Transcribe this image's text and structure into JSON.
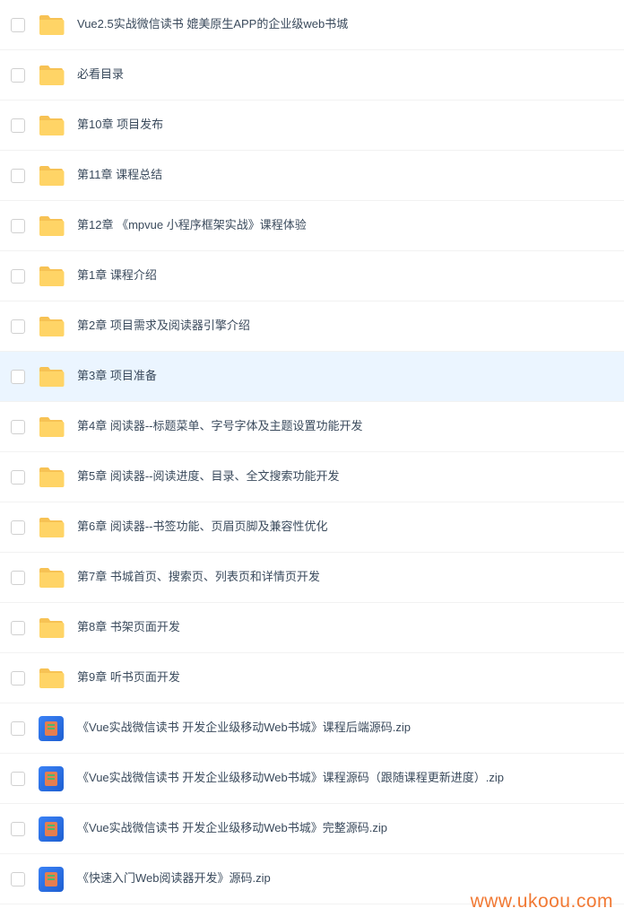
{
  "items": [
    {
      "type": "folder",
      "name": "Vue2.5实战微信读书 媲美原生APP的企业级web书城",
      "selected": false
    },
    {
      "type": "folder",
      "name": "必看目录",
      "selected": false
    },
    {
      "type": "folder",
      "name": "第10章 项目发布",
      "selected": false
    },
    {
      "type": "folder",
      "name": "第11章 课程总结",
      "selected": false
    },
    {
      "type": "folder",
      "name": "第12章 《mpvue 小程序框架实战》课程体验",
      "selected": false
    },
    {
      "type": "folder",
      "name": "第1章 课程介绍",
      "selected": false
    },
    {
      "type": "folder",
      "name": "第2章 项目需求及阅读器引擎介绍",
      "selected": false
    },
    {
      "type": "folder",
      "name": "第3章 项目准备",
      "selected": true
    },
    {
      "type": "folder",
      "name": "第4章 阅读器--标题菜单、字号字体及主题设置功能开发",
      "selected": false
    },
    {
      "type": "folder",
      "name": "第5章 阅读器--阅读进度、目录、全文搜索功能开发",
      "selected": false
    },
    {
      "type": "folder",
      "name": "第6章 阅读器--书签功能、页眉页脚及兼容性优化",
      "selected": false
    },
    {
      "type": "folder",
      "name": "第7章 书城首页、搜索页、列表页和详情页开发",
      "selected": false
    },
    {
      "type": "folder",
      "name": "第8章 书架页面开发",
      "selected": false
    },
    {
      "type": "folder",
      "name": "第9章 听书页面开发",
      "selected": false
    },
    {
      "type": "zip",
      "name": "《Vue实战微信读书 开发企业级移动Web书城》课程后端源码.zip",
      "selected": false
    },
    {
      "type": "zip",
      "name": "《Vue实战微信读书 开发企业级移动Web书城》课程源码（跟随课程更新进度）.zip",
      "selected": false
    },
    {
      "type": "zip",
      "name": "《Vue实战微信读书 开发企业级移动Web书城》完整源码.zip",
      "selected": false
    },
    {
      "type": "zip",
      "name": "《快速入门Web阅读器开发》源码.zip",
      "selected": false
    }
  ],
  "watermark": "www.ukoou.com"
}
